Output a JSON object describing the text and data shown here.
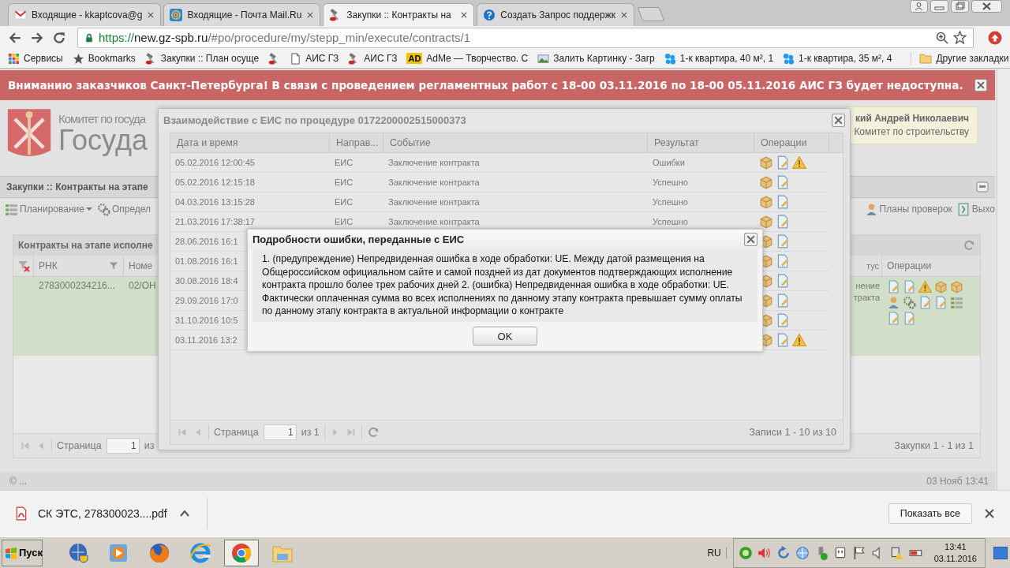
{
  "browser": {
    "tabs": [
      {
        "label": "Входящие - kkaptcova@g",
        "kind": "mail",
        "selected": false
      },
      {
        "label": "Входящие - Почта Mail.Ru",
        "kind": "at",
        "selected": false
      },
      {
        "label": "Закупки :: Контракты на",
        "kind": "hammer",
        "selected": true
      },
      {
        "label": "Создать Запрос поддержк",
        "kind": "help",
        "selected": false
      }
    ],
    "url": {
      "scheme": "https://",
      "host": "new.gz-spb.ru",
      "path": "/#po/procedure/my/stepp_min/execute/contracts/1"
    },
    "bookmarks": [
      {
        "label": "Сервисы",
        "kind": "apps"
      },
      {
        "label": "Bookmarks",
        "kind": "star"
      },
      {
        "label": "Закупки :: План осуще",
        "kind": "hammer"
      },
      {
        "kind": "hammer"
      },
      {
        "label": "АИС ГЗ",
        "kind": "page"
      },
      {
        "label": "АИС ГЗ",
        "kind": "hammer"
      },
      {
        "label": "AdMe — Творчество. С",
        "kind": "ad",
        "badge": "AD"
      },
      {
        "label": "Залить Картинку - Загр",
        "kind": "image"
      },
      {
        "label": "1-к квартира, 40 м², 1",
        "kind": "dots"
      },
      {
        "label": "1-к квартира, 35 м², 4",
        "kind": "dots"
      }
    ],
    "other_bookmarks": "Другие закладки"
  },
  "banner": {
    "text": "Вниманию заказчиков Санкт-Петербурга! В связи с проведением регламентных работ с 18-00 03.11.2016 по 18-00 05.11.2016 АИС ГЗ будет недоступна."
  },
  "header": {
    "org_line1": "Комитет по госуда",
    "org_line2": "Госуда",
    "user_name": "кий Андрей Николаевич",
    "user_org": "Комитет по строительству"
  },
  "panel": {
    "title": "Закупки :: Контракты на этапе",
    "menu_left": [
      {
        "label": "Планирование",
        "kind": "plan",
        "dropdown": true
      },
      {
        "label": "Определ",
        "kind": "gears",
        "dropdown": false
      }
    ],
    "menu_right": [
      {
        "label": "Планы проверок",
        "kind": "person",
        "dropdown": false
      },
      {
        "label": "Выхо",
        "kind": "exit",
        "dropdown": false
      }
    ]
  },
  "grid": {
    "title": "Контракты на этапе исполне",
    "columns_left": [
      "РНК",
      "Номе"
    ],
    "columns_right": [
      "тус",
      "Операции"
    ],
    "row": {
      "rnk": "2783000234216...",
      "number": "02/ОН",
      "status_lines": [
        "нение",
        "тракта"
      ],
      "selected": true
    },
    "paging": {
      "label": "Страница",
      "page": "1",
      "of": "из"
    },
    "summary": "Закупки 1 - 1 из 1"
  },
  "footer": {
    "left": "© ...",
    "right": "03 Нояб 13:41"
  },
  "modal": {
    "title": "Взаимодействие с ЕИС по процедуре 0172200002515000373",
    "columns": [
      "Дата и время",
      "Направ...",
      "Событие",
      "Результат",
      "Операции"
    ],
    "rows": [
      {
        "date": "05.02.2016 12:00:45",
        "direction": "ЕИС",
        "event": "Заключение контракта",
        "result": "Ошибки",
        "warning": true
      },
      {
        "date": "05.02.2016 12:15:18",
        "direction": "ЕИС",
        "event": "Заключение контракта",
        "result": "Успешно",
        "warning": false
      },
      {
        "date": "04.03.2016 13:15:28",
        "direction": "ЕИС",
        "event": "Заключение контракта",
        "result": "Успешно",
        "warning": false
      },
      {
        "date": "21.03.2016 17:38:17",
        "direction": "ЕИС",
        "event": "Заключение контракта",
        "result": "Успешно",
        "warning": false
      },
      {
        "date": "28.06.2016 16:1",
        "warning": false
      },
      {
        "date": "01.08.2016 16:1",
        "warning": false
      },
      {
        "date": "30.08.2016 18:4",
        "warning": false
      },
      {
        "date": "29.09.2016 17:0",
        "warning": false
      },
      {
        "date": "31.10.2016 10:5",
        "warning": false
      },
      {
        "date": "03.11.2016 13:2",
        "warning": true
      }
    ],
    "paging": {
      "label": "Страница",
      "page": "1",
      "of": "из 1"
    },
    "summary": "Записи 1 - 10 из 10"
  },
  "error_dialog": {
    "title": "Подробности ошибки, переданные с ЕИС",
    "message": "1. (предупреждение) Непредвиденная ошибка в ходе обработки: UE. Между датой размещения на Общероссийском официальном сайте и самой поздней из дат документов подтверждающих исполнение контракта прошло более трех рабочих дней 2. (ошибка) Непредвиденная ошибка в ходе обработки: UE. Фактически оплаченная сумма во всех исполнениях по данному этапу контракта превышает сумму оплаты по данному этапу контракта в актуальной информации о контракте",
    "button": "OK"
  },
  "downloads": {
    "file": "СК ЭТС, 278300023....pdf",
    "show_all": "Показать все"
  },
  "taskbar": {
    "start": "Пуск",
    "apps": [
      {
        "kind": "globe",
        "active": false
      },
      {
        "kind": "player",
        "active": false
      },
      {
        "kind": "firefox",
        "active": false
      },
      {
        "kind": "ie",
        "active": false
      },
      {
        "kind": "chrome",
        "active": true
      },
      {
        "kind": "folder",
        "active": false
      }
    ],
    "language": "RU",
    "time": "13:41",
    "date": "03.11.2016"
  }
}
